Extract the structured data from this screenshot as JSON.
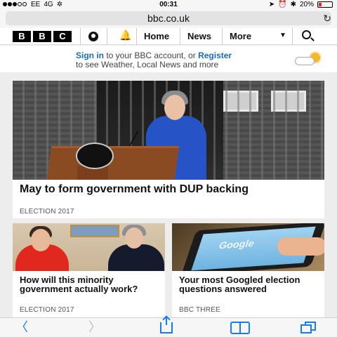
{
  "statusbar": {
    "carrier": "EE",
    "network": "4G",
    "time": "00:31",
    "battery": "20%",
    "battery_level": 0.2
  },
  "browser": {
    "url": "bbc.co.uk"
  },
  "bbc_nav": {
    "logo_letters": [
      "B",
      "B",
      "C"
    ],
    "home": "Home",
    "news": "News",
    "more": "More"
  },
  "signin_banner": {
    "signin_link": "Sign in",
    "text_1": " to your BBC account, or ",
    "register_link": "Register",
    "text_2": "to see Weather, Local News and more"
  },
  "top_story": {
    "headline": "May to form government with DUP backing",
    "category": "ELECTION 2017"
  },
  "cards": [
    {
      "headline": "How will this minority government actually work?",
      "category": "ELECTION 2017"
    },
    {
      "headline": "Your most Googled election questions answered",
      "category": "BBC THREE",
      "image_text": "Google"
    }
  ],
  "colors": {
    "accent": "#1a7af0",
    "signin_link": "#1a6bbd"
  }
}
